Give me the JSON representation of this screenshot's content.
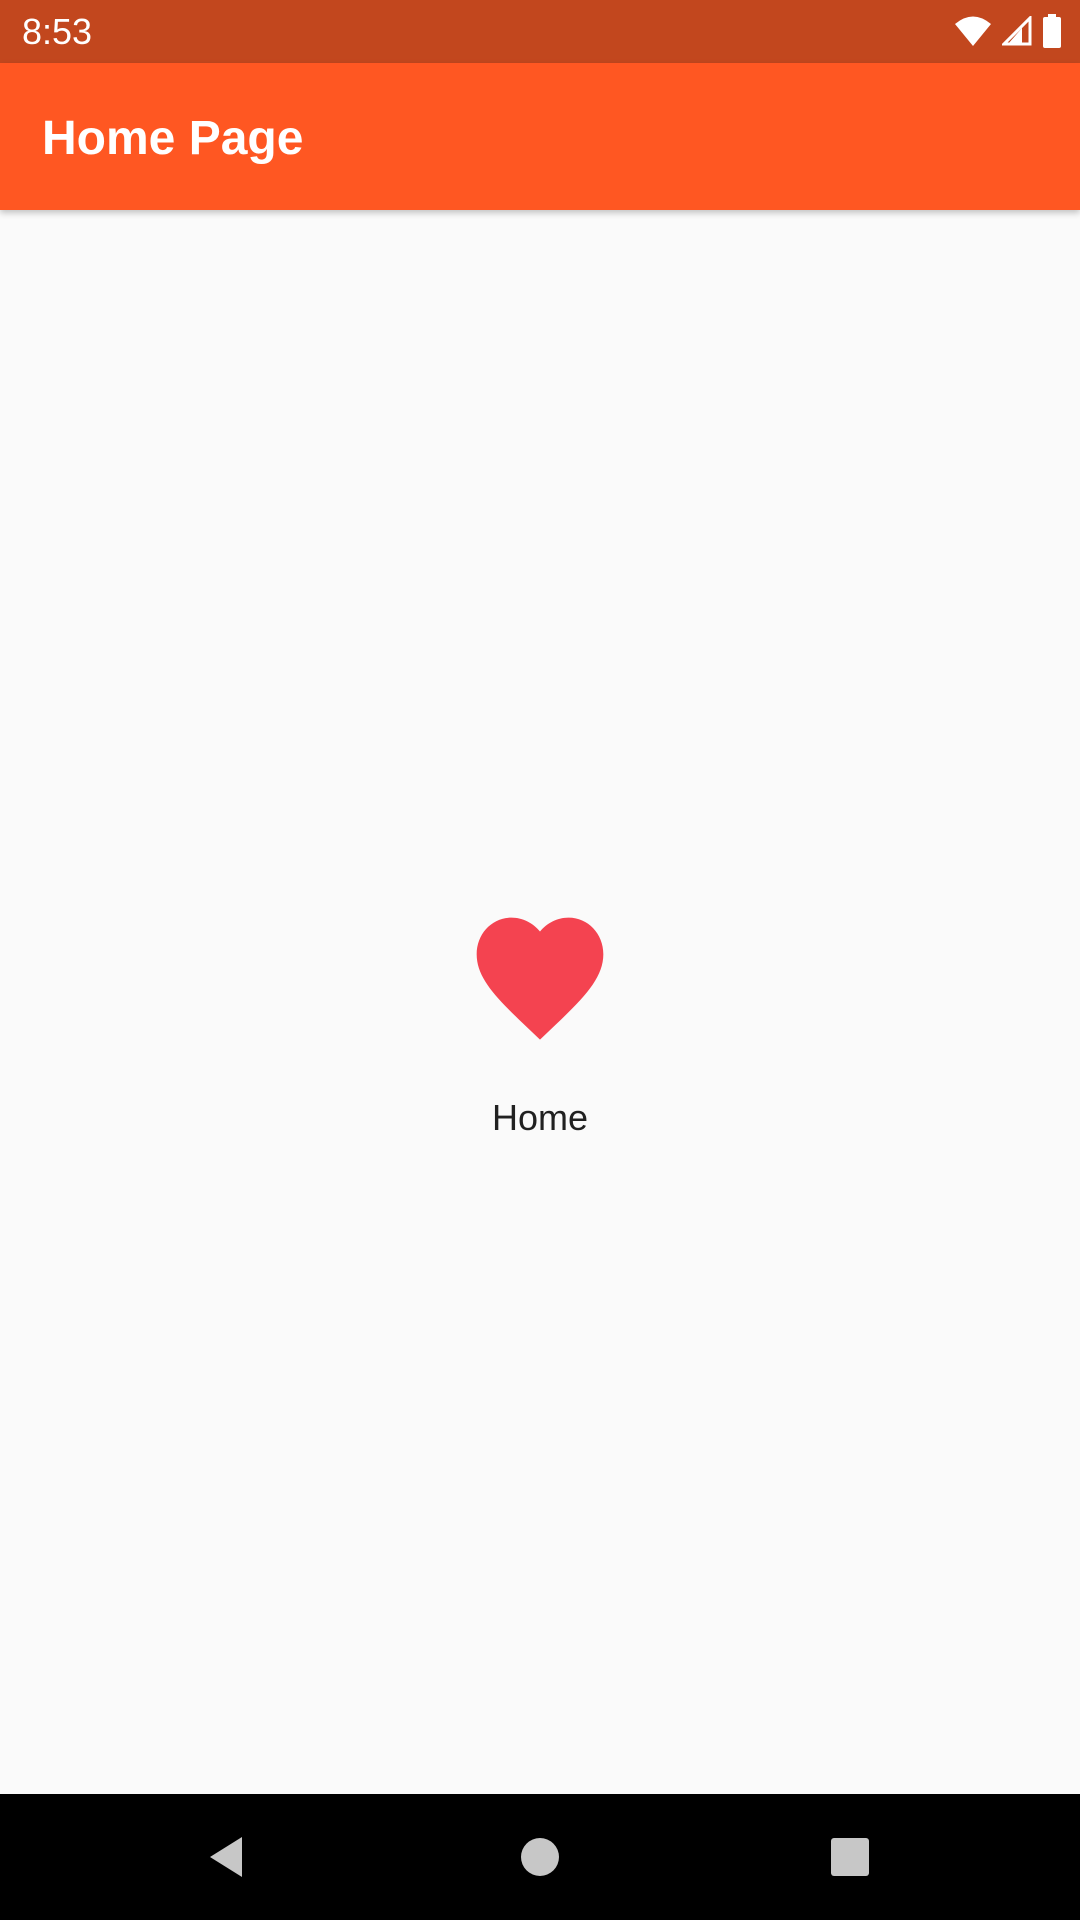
{
  "status_bar": {
    "time": "8:53",
    "icons": [
      "wifi-icon",
      "signal-icon",
      "battery-icon"
    ]
  },
  "app_bar": {
    "title": "Home Page",
    "color": "#FF5722"
  },
  "main": {
    "icon": "heart-icon",
    "icon_color": "#F44350",
    "label": "Home"
  },
  "nav_bar": {
    "buttons": [
      "back-icon",
      "home-icon",
      "recents-icon"
    ]
  }
}
